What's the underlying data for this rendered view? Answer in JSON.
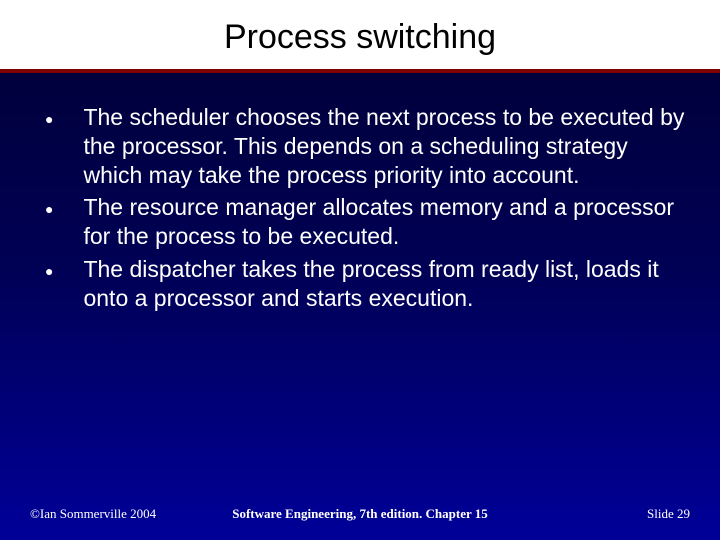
{
  "slide": {
    "title": "Process switching",
    "bullets": [
      "The scheduler chooses the next process to be executed by the processor. This depends on a scheduling strategy which may take the process priority into account.",
      "The resource manager allocates memory and a processor for the process to be executed.",
      "The dispatcher takes the process from ready list, loads it onto a processor and starts execution."
    ]
  },
  "footer": {
    "left": "©Ian Sommerville 2004",
    "center": "Software Engineering, 7th edition. Chapter 15",
    "right": "Slide 29"
  }
}
